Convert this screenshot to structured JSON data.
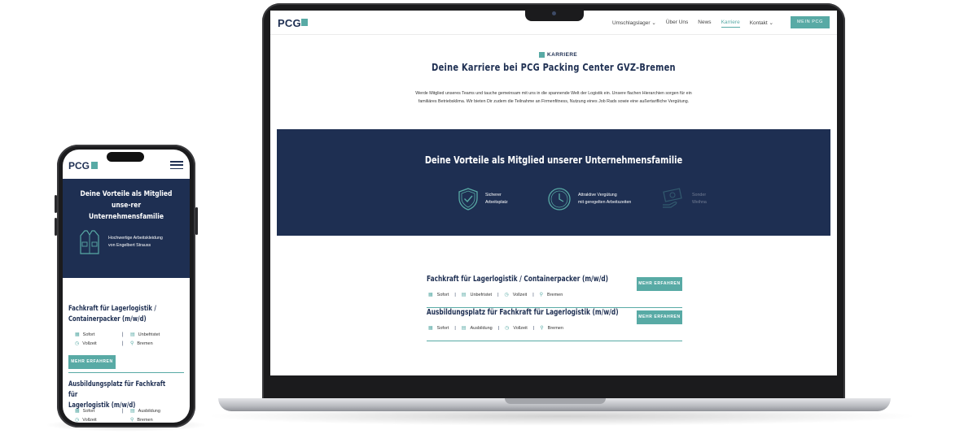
{
  "desktop": {
    "logo": "PCG",
    "nav": [
      {
        "label": "Umschlagslager",
        "has_dropdown": true,
        "active": false
      },
      {
        "label": "Über Uns",
        "has_dropdown": false,
        "active": false
      },
      {
        "label": "News",
        "has_dropdown": false,
        "active": false
      },
      {
        "label": "Karriere",
        "has_dropdown": false,
        "active": true
      },
      {
        "label": "Kontakt",
        "has_dropdown": true,
        "active": false
      }
    ],
    "mein_button": "MEIN PCG",
    "kicker": "KARRIERE",
    "heading": "Deine Karriere bei PCG Packing Center GVZ-Bremen",
    "intro_line1": "Werde Mitglied unseres Teams und tauche gemeinsam mit uns in die spannende Welt der Logistik ein. Unsere flachen Hierarchien sorgen für ein",
    "intro_line2": "familiäres Betriebsklima. Wir bieten Dir zudem die Teilnahme an Firmenfitness, Nutzung eines Job Rads sowie eine außertarifliche Vergütung.",
    "benefits_title": "Deine Vorteile als Mitglied unserer Unternehmensfamilie",
    "benefits": [
      {
        "icon": "shield-check-icon",
        "line1": "Sicherer",
        "line2": "Arbeitsplatz"
      },
      {
        "icon": "clock-icon",
        "line1": "Attraktive Vergütung",
        "line2": "mit geregelten Arbeitszeiten"
      },
      {
        "icon": "money-hand-icon",
        "line1": "Sonder",
        "line2": "Weihna"
      }
    ],
    "jobs": [
      {
        "title": "Fachkraft für Lagerlogistik / Containerpacker (m/w/d)",
        "start": "Sofort",
        "term": "Unbefristet",
        "hours": "Vollzeit",
        "location": "Bremen",
        "button": "MEHR ERFAHREN"
      },
      {
        "title": "Ausbildungsplatz für Fachkraft für Lagerlogistik (m/w/d)",
        "start": "Sofort",
        "term": "Ausbildung",
        "hours": "Vollzeit",
        "location": "Bremen",
        "button": "MEHR ERFAHREN"
      }
    ]
  },
  "mobile": {
    "logo": "PCG",
    "benefits_title": "Deine Vorteile als Mitglied unse-rer Unternehmensfamilie",
    "benefit": {
      "icon": "vest-icon",
      "line1": "Hochwertige Arbeitskleidung",
      "line2": "von Engelbert Strauss"
    },
    "jobs": [
      {
        "title_line1": "Fachkraft für Lagerlogistik /",
        "title_line2": "Containerpacker (m/w/d)",
        "start": "Sofort",
        "term": "Unbefristet",
        "hours": "Vollzeit",
        "location": "Bremen",
        "button": "MEHR ERFAHREN"
      },
      {
        "title_line1": "Ausbildungsplatz für Fachkraft für",
        "title_line2": "Lagerlogistik (m/w/d)",
        "start": "Sofort",
        "term": "Ausbildung",
        "hours": "Vollzeit",
        "location": "Bremen"
      }
    ]
  },
  "colors": {
    "navy": "#1e2f52",
    "teal": "#58aaa5"
  }
}
